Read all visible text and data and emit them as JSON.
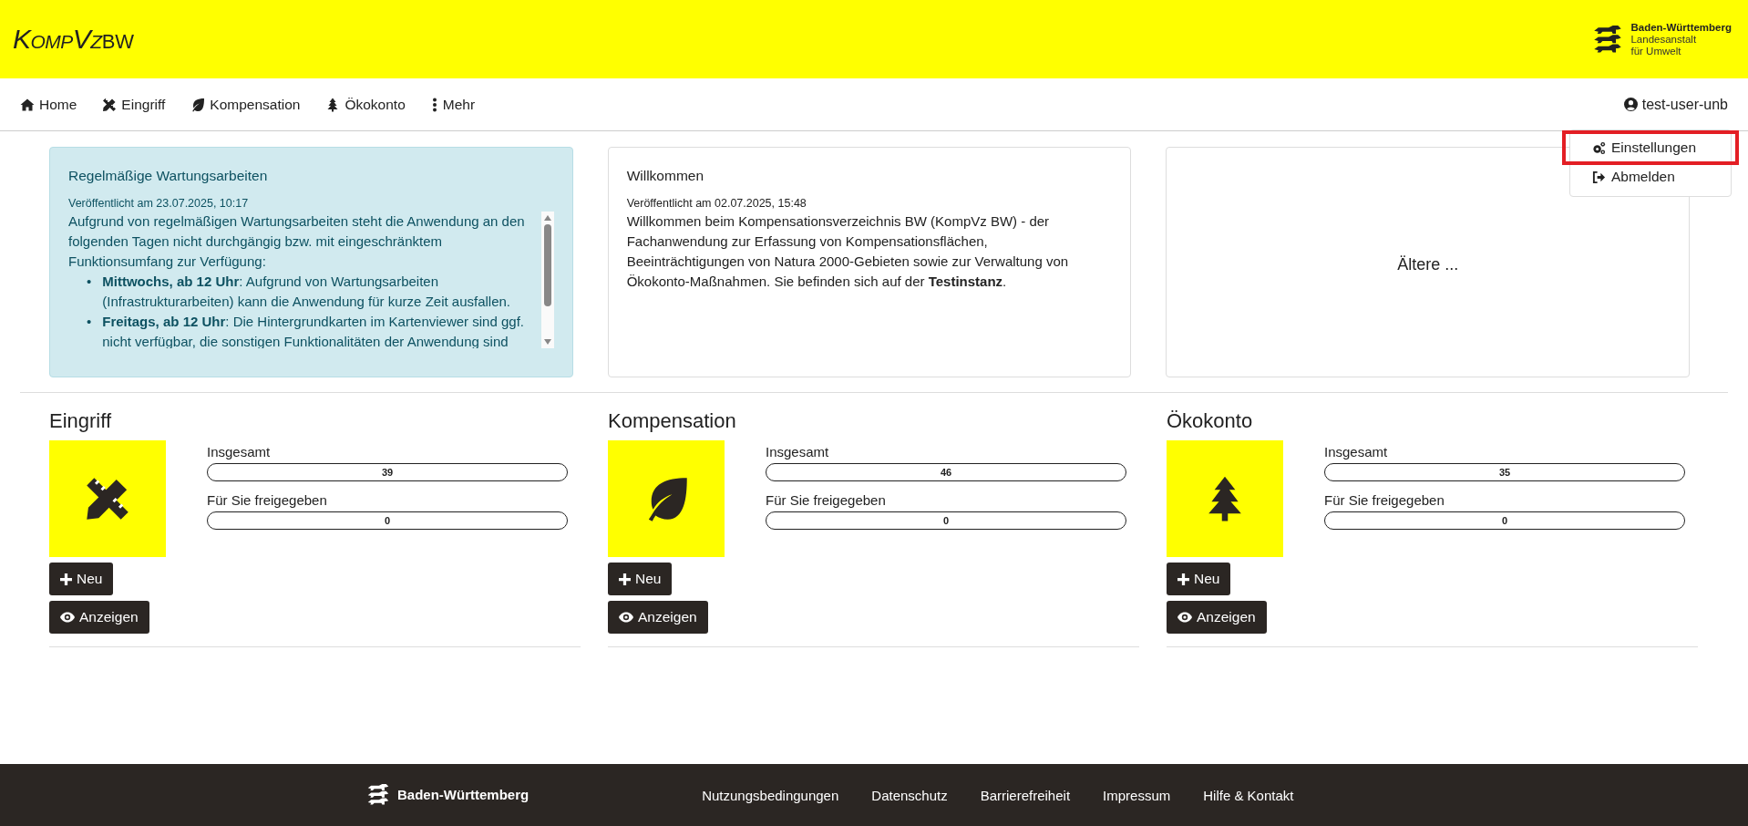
{
  "header": {
    "logo_main": "KompVz",
    "logo_sub": "BW",
    "org": [
      "Baden-Württemberg",
      "Landesanstalt",
      "für Umwelt"
    ]
  },
  "nav": [
    {
      "label": "Home",
      "kind": "home"
    },
    {
      "label": "Eingriff",
      "kind": "eingriff"
    },
    {
      "label": "Kompensation",
      "kind": "kompensation"
    },
    {
      "label": "Ökokonto",
      "kind": "oekokonto"
    },
    {
      "label": "Mehr",
      "kind": "more"
    }
  ],
  "user": {
    "name": "test-user-unb",
    "menu": [
      {
        "label": "Einstellungen",
        "kind": "settings",
        "highlighted": true
      },
      {
        "label": "Abmelden",
        "kind": "logout",
        "highlighted": false
      }
    ]
  },
  "news": [
    {
      "kind": "info",
      "title": "Regelmäßige Wartungsarbeiten",
      "date": "Veröffentlicht am 23.07.2025, 10:17",
      "text": "Aufgrund von regelmäßigen Wartungsarbeiten steht die Anwendung an den folgenden Tagen nicht durchgängig bzw. mit eingeschränktem Funktionsumfang zur Verfügung:",
      "bullets": [
        {
          "marker": "•",
          "text": "**Mittwochs, ab 12 Uhr**: Aufgrund von Wartungsarbeiten (Infrastrukturarbeiten) kann die Anwendung für kurze Zeit ausfallen."
        },
        {
          "marker": "•",
          "text": "**Freitags, ab 12 Uhr**: Die Hintergrundkarten im Kartenviewer sind ggf. nicht verfügbar, die sonstigen Funktionalitäten der Anwendung sind"
        }
      ]
    },
    {
      "kind": "plain",
      "title": "Willkommen",
      "date": "Veröffentlicht am 02.07.2025, 15:48",
      "text": "Willkommen beim Kompensationsverzeichnis BW (KompVz BW) - der Fachanwendung zur Erfassung von Kompensationsflächen, Beeinträchtigungen von Natura 2000-Gebieten sowie zur Verwaltung von Ökokonto-Maßnahmen. Sie befinden sich auf der **Testinstanz**."
    },
    {
      "kind": "more",
      "label": "Ältere ..."
    }
  ],
  "sections": [
    {
      "title": "Eingriff",
      "kind": "eingriff",
      "stats": [
        {
          "label": "Insgesamt",
          "value": "39"
        },
        {
          "label": "Für Sie freigegeben",
          "value": "0"
        }
      ],
      "buttons": [
        {
          "label": "Neu",
          "kind": "new"
        },
        {
          "label": "Anzeigen",
          "kind": "view"
        }
      ]
    },
    {
      "title": "Kompensation",
      "kind": "kompensation",
      "stats": [
        {
          "label": "Insgesamt",
          "value": "46"
        },
        {
          "label": "Für Sie freigegeben",
          "value": "0"
        }
      ],
      "buttons": [
        {
          "label": "Neu",
          "kind": "new"
        },
        {
          "label": "Anzeigen",
          "kind": "view"
        }
      ]
    },
    {
      "title": "Ökokonto",
      "kind": "oekokonto",
      "stats": [
        {
          "label": "Insgesamt",
          "value": "35"
        },
        {
          "label": "Für Sie freigegeben",
          "value": "0"
        }
      ],
      "buttons": [
        {
          "label": "Neu",
          "kind": "new"
        },
        {
          "label": "Anzeigen",
          "kind": "view"
        }
      ]
    }
  ],
  "footer": {
    "brand": "Baden-Württemberg",
    "links": [
      "Nutzungsbedingungen",
      "Datenschutz",
      "Barrierefreiheit",
      "Impressum",
      "Hilfe & Kontakt"
    ]
  }
}
